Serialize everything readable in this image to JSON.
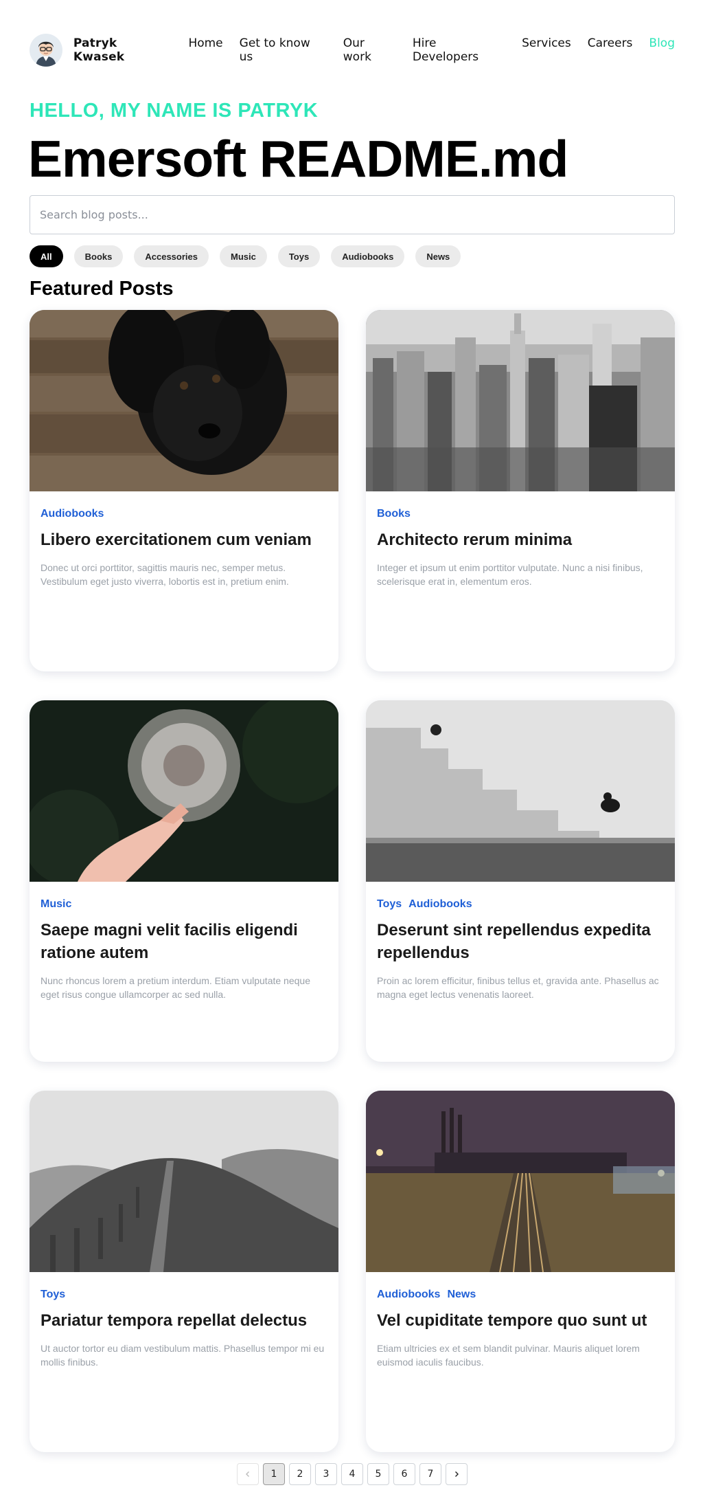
{
  "header": {
    "brand_name": "Patryk Kwasek",
    "nav": [
      {
        "label": "Home",
        "active": false
      },
      {
        "label": "Get to know us",
        "active": false
      },
      {
        "label": "Our work",
        "active": false
      },
      {
        "label": "Hire Developers",
        "active": false
      },
      {
        "label": "Services",
        "active": false
      },
      {
        "label": "Careers",
        "active": false
      },
      {
        "label": "Blog",
        "active": true
      }
    ]
  },
  "hero": {
    "hello": "HELLO, MY NAME IS PATRYK",
    "title": "Emersoft README.md"
  },
  "search": {
    "placeholder": "Search blog posts...",
    "value": ""
  },
  "filters": [
    {
      "label": "All",
      "active": true
    },
    {
      "label": "Books",
      "active": false
    },
    {
      "label": "Accessories",
      "active": false
    },
    {
      "label": "Music",
      "active": false
    },
    {
      "label": "Toys",
      "active": false
    },
    {
      "label": "Audiobooks",
      "active": false
    },
    {
      "label": "News",
      "active": false
    }
  ],
  "section_title": "Featured Posts",
  "posts": [
    {
      "categories": [
        "Audiobooks"
      ],
      "title": "Libero exercitationem cum veniam",
      "description": "Donec ut orci porttitor, sagittis mauris nec, semper metus. Vestibulum eget justo viverra, lobortis est in, pretium enim.",
      "image": "black-puppy-photo"
    },
    {
      "categories": [
        "Books"
      ],
      "title": "Architecto rerum minima",
      "description": "Integer et ipsum ut enim porttitor vulputate. Nunc a nisi finibus, scelerisque erat in, elementum eros.",
      "image": "city-skyline-photo"
    },
    {
      "categories": [
        "Music"
      ],
      "title": "Saepe magni velit facilis eligendi ratione autem",
      "description": "Nunc rhoncus lorem a pretium interdum. Etiam vulputate neque eget risus congue ullamcorper ac sed nulla.",
      "image": "dandelion-photo"
    },
    {
      "categories": [
        "Toys",
        "Audiobooks"
      ],
      "title": "Deserunt sint repellendus expedita repellendus",
      "description": "Proin ac lorem efficitur, finibus tellus et, gravida ante. Phasellus ac magna eget lectus venenatis laoreet.",
      "image": "stone-stairs-photo"
    },
    {
      "categories": [
        "Toys"
      ],
      "title": "Pariatur tempora repellat delectus",
      "description": "Ut auctor tortor eu diam vestibulum mattis. Phasellus tempor mi eu mollis finibus.",
      "image": "hills-fence-photo"
    },
    {
      "categories": [
        "Audiobooks",
        "News"
      ],
      "title": "Vel cupiditate tempore quo sunt ut",
      "description": "Etiam ultricies ex et sem blandit pulvinar. Mauris aliquet lorem euismod iaculis faucibus.",
      "image": "railway-night-photo"
    }
  ],
  "pagination": {
    "prev_icon": "chevron-left-icon",
    "next_icon": "chevron-right-icon",
    "pages": [
      "1",
      "2",
      "3",
      "4",
      "5",
      "6",
      "7"
    ],
    "current": "1"
  },
  "colors": {
    "accent": "#2ee6b8",
    "category": "#1f5fd6",
    "chip_active": "#000000",
    "chip": "#ebebeb"
  }
}
